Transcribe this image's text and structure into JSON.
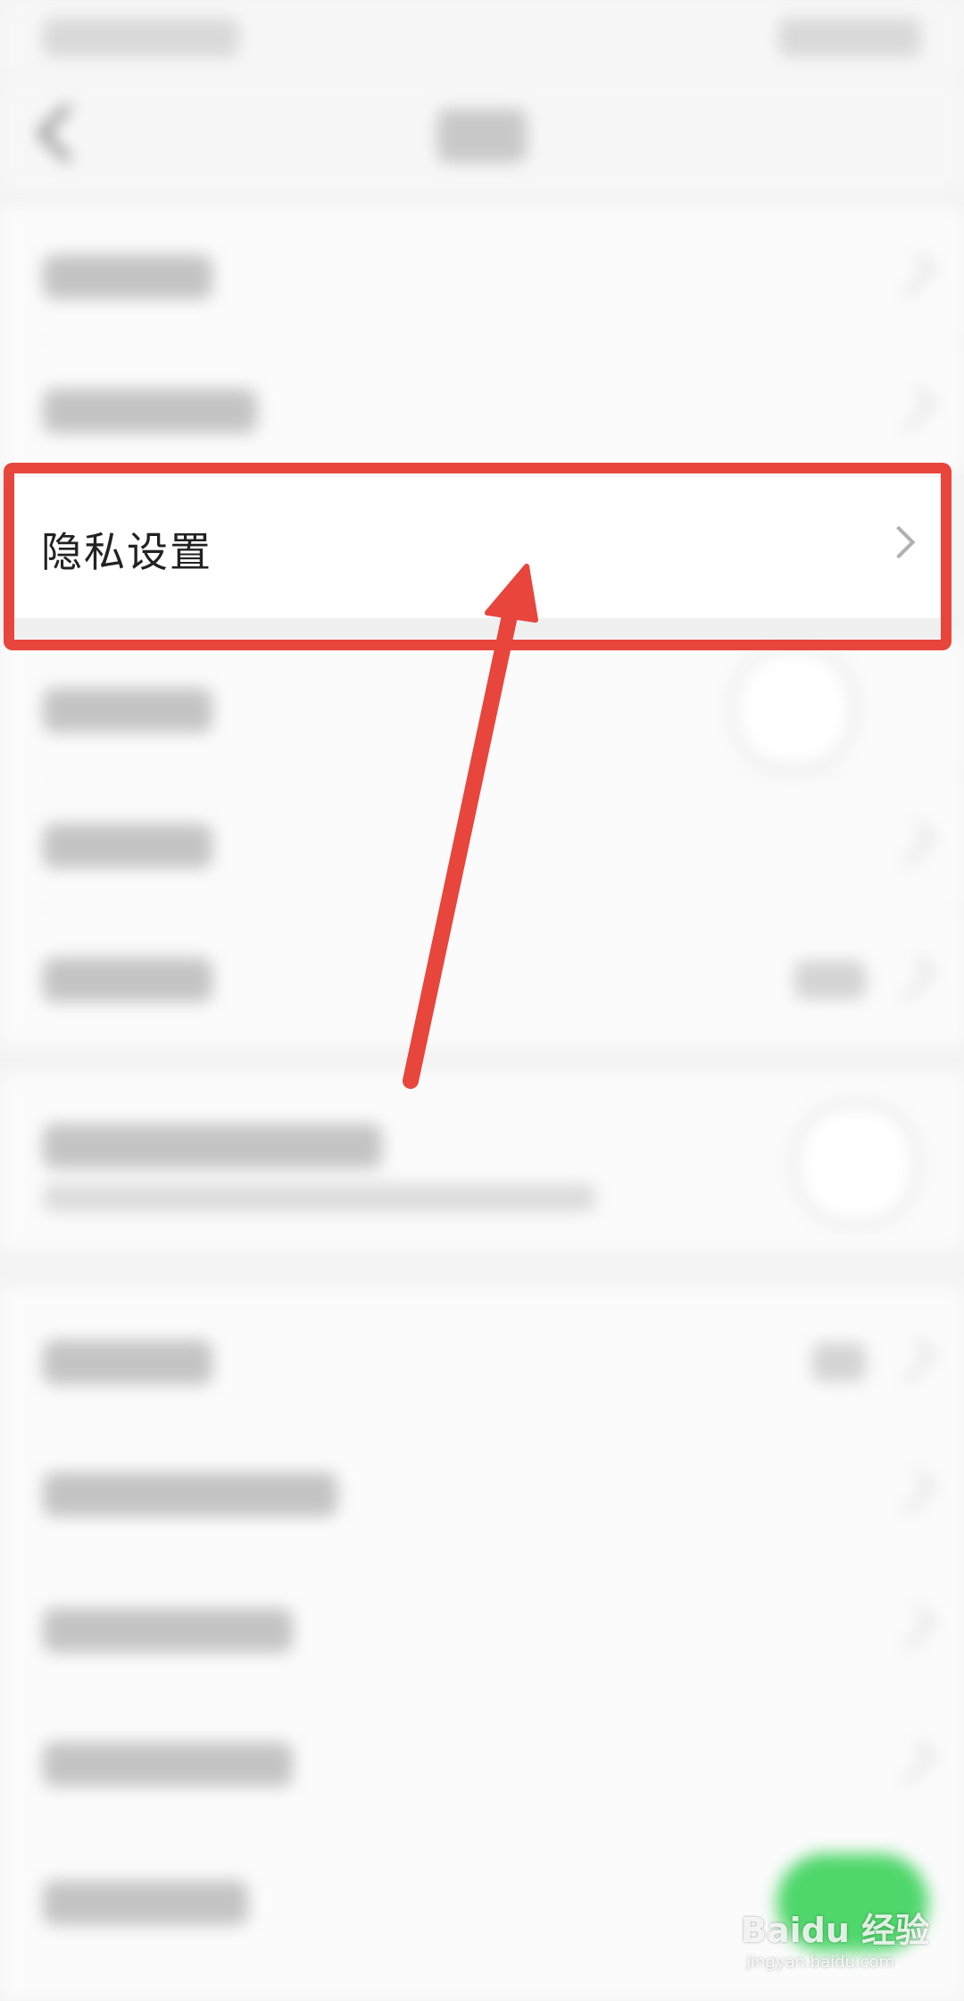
{
  "highlighted_row": {
    "label": "隐私设置"
  },
  "watermark": {
    "brand": "Baidu 经验",
    "url": "jingyan.baidu.com"
  },
  "colors": {
    "highlight_border": "#e8453c",
    "arrow": "#e8453c",
    "toggle_on": "#4fd76b"
  }
}
